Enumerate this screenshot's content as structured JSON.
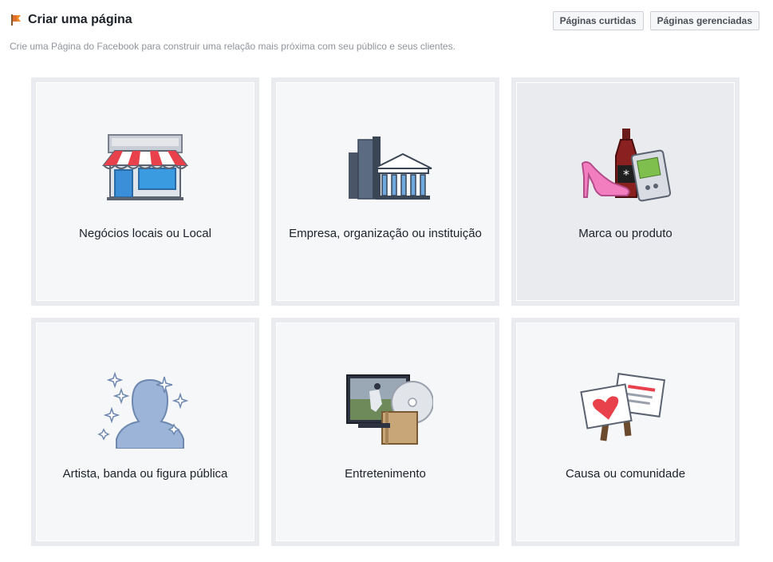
{
  "header": {
    "title": "Criar uma página",
    "subtitle": "Crie uma Página do Facebook para construir uma relação mais próxima com seu público e seus clientes.",
    "buttons": {
      "liked_pages": "Páginas curtidas",
      "managed_pages": "Páginas gerenciadas"
    }
  },
  "categories": [
    {
      "label": "Negócios locais ou Local",
      "icon": "storefront-icon"
    },
    {
      "label": "Empresa, organização ou instituição",
      "icon": "buildings-icon"
    },
    {
      "label": "Marca ou produto",
      "icon": "products-icon"
    },
    {
      "label": "Artista, banda ou figura pública",
      "icon": "public-figure-icon"
    },
    {
      "label": "Entretenimento",
      "icon": "entertainment-icon"
    },
    {
      "label": "Causa ou comunidade",
      "icon": "cause-signs-icon"
    }
  ],
  "colors": {
    "card_border": "#e9ebee",
    "card_bg": "#f6f7f9",
    "card_hover_bg": "#e9ebee",
    "text": "#1d2129",
    "subtitle": "#90949c"
  }
}
